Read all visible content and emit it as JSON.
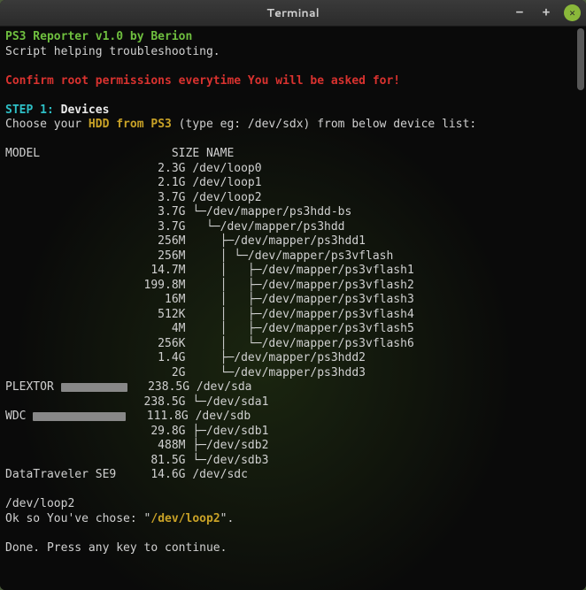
{
  "window": {
    "title": "Terminal"
  },
  "header": {
    "app_name": "PS3 Reporter v1.0 by Berion",
    "tagline": "Script helping troubleshooting."
  },
  "warn": "Confirm root permissions everytime You will be asked for!",
  "step": {
    "label": "STEP 1: ",
    "title": "Devices"
  },
  "choose_line": {
    "prefix": "Choose your ",
    "highlight": "HDD from PS3",
    "suffix": " (type eg: /dev/sdx) from below device list:"
  },
  "table_header": "MODEL                   SIZE NAME",
  "devices": [
    {
      "model": "",
      "size": "2.3G",
      "tree": "",
      "name": "/dev/loop0"
    },
    {
      "model": "",
      "size": "2.1G",
      "tree": "",
      "name": "/dev/loop1"
    },
    {
      "model": "",
      "size": "3.7G",
      "tree": "",
      "name": "/dev/loop2"
    },
    {
      "model": "",
      "size": "3.7G",
      "tree": "└─",
      "name": "/dev/mapper/ps3hdd-bs"
    },
    {
      "model": "",
      "size": "3.7G",
      "tree": "  └─",
      "name": "/dev/mapper/ps3hdd"
    },
    {
      "model": "",
      "size": "256M",
      "tree": "    ├─",
      "name": "/dev/mapper/ps3hdd1"
    },
    {
      "model": "",
      "size": "256M",
      "tree": "    │ └─",
      "name": "/dev/mapper/ps3vflash"
    },
    {
      "model": "",
      "size": "14.7M",
      "tree": "    │   ├─",
      "name": "/dev/mapper/ps3vflash1"
    },
    {
      "model": "",
      "size": "199.8M",
      "tree": "    │   ├─",
      "name": "/dev/mapper/ps3vflash2"
    },
    {
      "model": "",
      "size": "16M",
      "tree": "    │   ├─",
      "name": "/dev/mapper/ps3vflash3"
    },
    {
      "model": "",
      "size": "512K",
      "tree": "    │   ├─",
      "name": "/dev/mapper/ps3vflash4"
    },
    {
      "model": "",
      "size": "4M",
      "tree": "    │   ├─",
      "name": "/dev/mapper/ps3vflash5"
    },
    {
      "model": "",
      "size": "256K",
      "tree": "    │   └─",
      "name": "/dev/mapper/ps3vflash6"
    },
    {
      "model": "",
      "size": "1.4G",
      "tree": "    ├─",
      "name": "/dev/mapper/ps3hdd2"
    },
    {
      "model": "",
      "size": "2G",
      "tree": "    └─",
      "name": "/dev/mapper/ps3hdd3"
    },
    {
      "model": "PLEXTOR",
      "size": "238.5G",
      "tree": "",
      "name": "/dev/sda",
      "redacted": true
    },
    {
      "model": "",
      "size": "238.5G",
      "tree": "└─",
      "name": "/dev/sda1"
    },
    {
      "model": "WDC",
      "size": "111.8G",
      "tree": "",
      "name": "/dev/sdb",
      "redacted": true
    },
    {
      "model": "",
      "size": "29.8G",
      "tree": "├─",
      "name": "/dev/sdb1"
    },
    {
      "model": "",
      "size": "488M",
      "tree": "├─",
      "name": "/dev/sdb2"
    },
    {
      "model": "",
      "size": "81.5G",
      "tree": "└─",
      "name": "/dev/sdb3"
    },
    {
      "model": "DataTraveler SE9",
      "size": "14.6G",
      "tree": "",
      "name": "/dev/sdc"
    }
  ],
  "input": "/dev/loop2",
  "confirm": {
    "prefix": "Ok so You've chose: \"",
    "value": "/dev/loop2",
    "suffix": "\"."
  },
  "done": "Done. Press any key to continue."
}
